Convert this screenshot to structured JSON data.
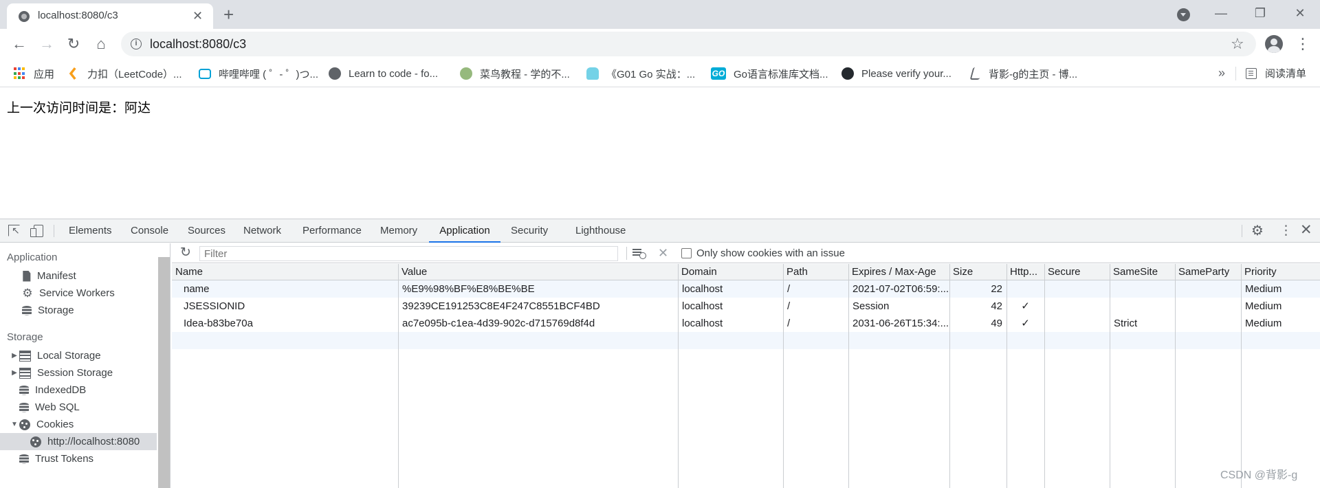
{
  "browser": {
    "tab_title": "localhost:8080/c3",
    "url": "localhost:8080/c3",
    "window_controls": {
      "minimize": "—",
      "restore": "❐",
      "close": "✕"
    }
  },
  "bookmarks": {
    "items": [
      {
        "label": "应用",
        "icon": "apps-grid-icon"
      },
      {
        "label": "力扣（LeetCode）...",
        "icon": "leetcode-icon",
        "color": "#f89f1b"
      },
      {
        "label": "哔哩哔哩 ( ゜- ゜)つ...",
        "icon": "bilibili-icon",
        "color": "#00a1d6"
      },
      {
        "label": "Learn to code - fo...",
        "icon": "globe-icon",
        "color": "#5f6368"
      },
      {
        "label": "菜鸟教程 - 学的不...",
        "icon": "runoob-icon",
        "color": "#96b97d"
      },
      {
        "label": "《G01 Go 实战：...",
        "icon": "go-gopher-icon",
        "color": "#74d2e7"
      },
      {
        "label": "Go语言标准库文档...",
        "icon": "go-logo-icon",
        "color": "#00acd7"
      },
      {
        "label": "Please verify your...",
        "icon": "github-icon",
        "color": "#24292e"
      },
      {
        "label": "背影-g的主页 - 博...",
        "icon": "profile-link-icon",
        "color": "#5f6368"
      }
    ],
    "more": "»",
    "reading_list": "阅读清单"
  },
  "page": {
    "text": "上一次访问时间是：阿达"
  },
  "devtools": {
    "tabs": [
      "Elements",
      "Console",
      "Sources",
      "Network",
      "Performance",
      "Memory",
      "Application",
      "Security",
      "Lighthouse"
    ],
    "active_tab": "Application",
    "sidebar": {
      "application_header": "Application",
      "application_items": [
        "Manifest",
        "Service Workers",
        "Storage"
      ],
      "storage_header": "Storage",
      "storage_items": [
        "Local Storage",
        "Session Storage",
        "IndexedDB",
        "Web SQL",
        "Cookies",
        "http://localhost:8080",
        "Trust Tokens"
      ]
    },
    "cookies": {
      "filter_placeholder": "Filter",
      "issue_checkbox_label": "Only show cookies with an issue",
      "columns": [
        "Name",
        "Value",
        "Domain",
        "Path",
        "Expires / Max-Age",
        "Size",
        "Http...",
        "Secure",
        "SameSite",
        "SameParty",
        "Priority"
      ],
      "rows": [
        [
          "name",
          "%E9%98%BF%E8%BE%BE",
          "localhost",
          "/",
          "2021-07-02T06:59:...",
          "22",
          "",
          "",
          "",
          "",
          "Medium"
        ],
        [
          "JSESSIONID",
          "39239CE191253C8E4F247C8551BCF4BD",
          "localhost",
          "/",
          "Session",
          "42",
          "✓",
          "",
          "",
          "",
          "Medium"
        ],
        [
          "Idea-b83be70a",
          "ac7e095b-c1ea-4d39-902c-d715769d8f4d",
          "localhost",
          "/",
          "2031-06-26T15:34:...",
          "49",
          "✓",
          "",
          "Strict",
          "",
          "Medium"
        ]
      ]
    }
  },
  "watermark": "CSDN @背影-g"
}
